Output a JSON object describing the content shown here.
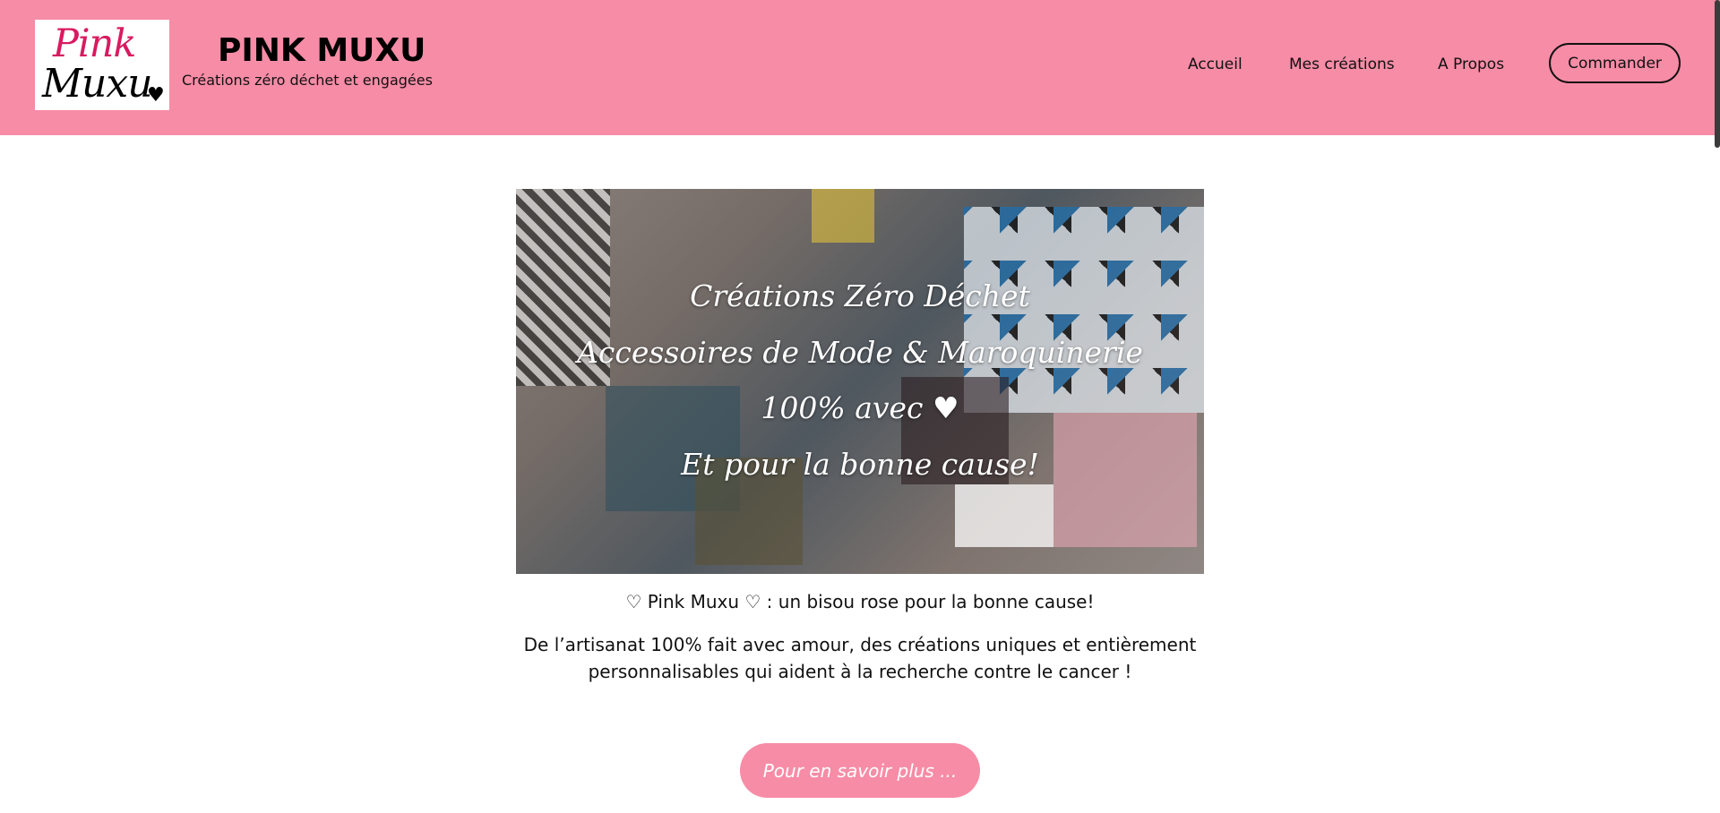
{
  "header": {
    "logo": {
      "line1": "Pink",
      "line2": "Muxu",
      "heart": "♥"
    },
    "title": "PINK MUXU",
    "tagline": "Créations zéro déchet et engagées",
    "nav": [
      "Accueil",
      "Mes créations",
      "A Propos"
    ],
    "order_button": "Commander"
  },
  "colors": {
    "brand_pink": "#f78ca6",
    "logo_pink": "#d81b60"
  },
  "hero": {
    "lines": [
      "Créations Zéro Déchet",
      "Accessoires de Mode & Maroquinerie",
      "100% avec ♥",
      "Et pour la bonne cause!"
    ]
  },
  "main": {
    "intro": "♡ Pink Muxu ♡ : un bisou rose pour la bonne cause!",
    "description": "De l’artisanat 100% fait avec amour, des créations uniques et entièrement personnalisables qui aident à la recherche contre le cancer !",
    "more_button": "Pour en savoir plus ..."
  }
}
